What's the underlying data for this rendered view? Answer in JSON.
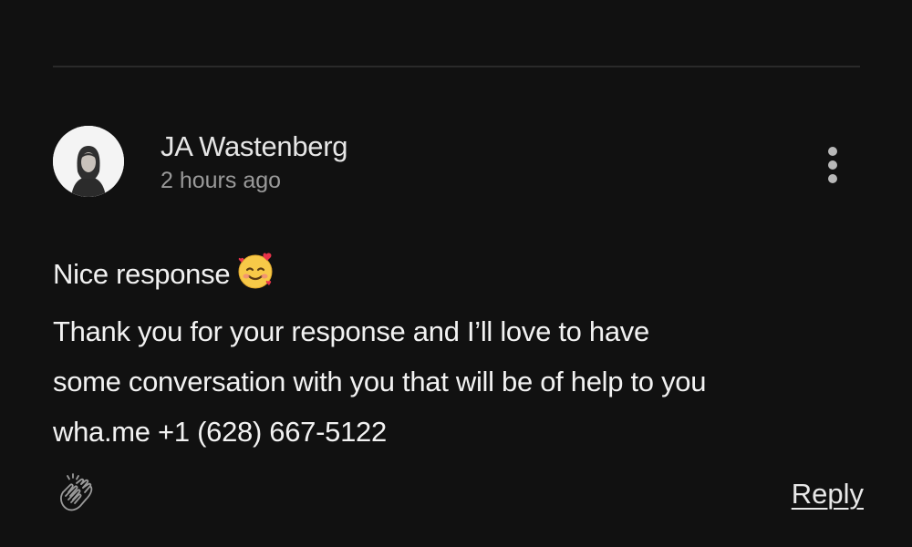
{
  "comment": {
    "author": "JA Wastenberg",
    "timestamp": "2 hours ago",
    "avatar_icon": "person-portrait-icon",
    "body_lines": [
      "Nice response",
      "Thank you for your response and I’ll love to have",
      "some conversation with you that will be of help to you",
      "wha.me +1 (628) 667-5122"
    ],
    "emoji": "smiling-face-with-hearts-icon"
  },
  "actions": {
    "more_icon": "more-vertical-icon",
    "clap_icon": "clap-icon",
    "reply_label": "Reply"
  },
  "colors": {
    "background": "#111111",
    "text": "#f2f2f2",
    "muted": "#9a9a9a",
    "divider": "#2a2a2a"
  }
}
